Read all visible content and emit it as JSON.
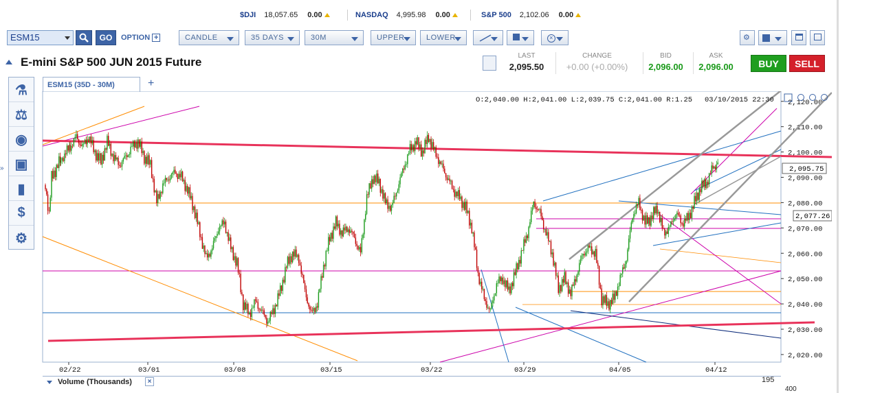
{
  "ticker": [
    {
      "name": "$DJI",
      "value": "18,057.65",
      "change": "0.00"
    },
    {
      "name": "NASDAQ",
      "value": "4,995.98",
      "change": "0.00"
    },
    {
      "name": "S&P 500",
      "value": "2,102.06",
      "change": "0.00"
    }
  ],
  "toolbar": {
    "symbol": "ESM15",
    "go": "GO",
    "option": "OPTION",
    "chart_type": "CANDLE",
    "range": "35 DAYS",
    "interval": "30M",
    "upper": "UPPER",
    "lower": "LOWER"
  },
  "title": "E-mini S&P 500 JUN 2015 Future",
  "quote": {
    "last_label": "LAST",
    "last": "2,095.50",
    "change_label": "CHANGE",
    "change": "+0.00 (+0.00%)",
    "bid_label": "BID",
    "bid": "2,096.00",
    "ask_label": "ASK",
    "ask": "2,096.00"
  },
  "buy_label": "BUY",
  "sell_label": "SELL",
  "tab_label": "ESM15 (35D - 30M)",
  "volume_panel": {
    "label": "Volume (Thousands)",
    "value": "195",
    "axis_top": "400"
  },
  "sidebar_icons": [
    "microscope-icon",
    "scale-icon",
    "eye-icon",
    "briefcase-icon",
    "bar-chart-icon",
    "dollar-icon",
    "gear-icon"
  ],
  "colors": {
    "up": "#1a9a1a",
    "down": "#c00000",
    "accent": "#3d64a6"
  },
  "chart_data": {
    "type": "candlestick",
    "ohlc_label": "O:2,040.00  H:2,041.00  L:2,039.75  C:2,041.00  R:1.25",
    "timestamp": "03/10/2015 22:30",
    "x_ticks": [
      "02/22",
      "03/01",
      "03/08",
      "03/15",
      "03/22",
      "03/29",
      "04/05",
      "04/12"
    ],
    "y_ticks": [
      "2,120.00",
      "2,110.00",
      "2,100.00",
      "2,090.00",
      "2,080.00",
      "2,070.00",
      "2,060.00",
      "2,050.00",
      "2,040.00",
      "2,030.00",
      "2,020.00"
    ],
    "ylim": [
      2017,
      2124
    ],
    "y_labels": [
      "2,095.75",
      "2,077.26"
    ],
    "price_path": [
      [
        0,
        2087
      ],
      [
        0.6,
        2075
      ],
      [
        1,
        2090
      ],
      [
        2.5,
        2097
      ],
      [
        4,
        2102
      ],
      [
        5,
        2106
      ],
      [
        6,
        2102
      ],
      [
        7,
        2106
      ],
      [
        8,
        2100
      ],
      [
        9,
        2096
      ],
      [
        10,
        2104
      ],
      [
        11,
        2098
      ],
      [
        12,
        2095
      ],
      [
        13,
        2098
      ],
      [
        14,
        2102
      ],
      [
        15,
        2104
      ],
      [
        16,
        2098
      ],
      [
        17,
        2095
      ],
      [
        18,
        2080
      ],
      [
        19,
        2087
      ],
      [
        20,
        2090
      ],
      [
        21,
        2092
      ],
      [
        22,
        2090
      ],
      [
        23,
        2085
      ],
      [
        24,
        2078
      ],
      [
        25,
        2068
      ],
      [
        26,
        2058
      ],
      [
        27,
        2062
      ],
      [
        28,
        2070
      ],
      [
        29,
        2072
      ],
      [
        30,
        2062
      ],
      [
        31,
        2056
      ],
      [
        32,
        2040
      ],
      [
        33,
        2036
      ],
      [
        34,
        2041
      ],
      [
        35,
        2037
      ],
      [
        36,
        2033
      ],
      [
        37,
        2038
      ],
      [
        38,
        2045
      ],
      [
        39,
        2055
      ],
      [
        40,
        2060
      ],
      [
        41,
        2058
      ],
      [
        42,
        2045
      ],
      [
        43,
        2036
      ],
      [
        44,
        2040
      ],
      [
        45,
        2055
      ],
      [
        46,
        2066
      ],
      [
        47,
        2072
      ],
      [
        48,
        2068
      ],
      [
        49,
        2070
      ],
      [
        50,
        2066
      ],
      [
        51,
        2060
      ],
      [
        52,
        2082
      ],
      [
        53,
        2090
      ],
      [
        54,
        2088
      ],
      [
        55,
        2080
      ],
      [
        56,
        2078
      ],
      [
        57,
        2086
      ],
      [
        58,
        2094
      ],
      [
        59,
        2101
      ],
      [
        60,
        2104
      ],
      [
        61,
        2100
      ],
      [
        62,
        2106
      ],
      [
        63,
        2100
      ],
      [
        64,
        2095
      ],
      [
        65,
        2090
      ],
      [
        66,
        2085
      ],
      [
        67,
        2082
      ],
      [
        68,
        2078
      ],
      [
        69,
        2070
      ],
      [
        70,
        2052
      ],
      [
        71,
        2042
      ],
      [
        72,
        2037
      ],
      [
        73,
        2048
      ],
      [
        74,
        2050
      ],
      [
        75,
        2045
      ],
      [
        76,
        2052
      ],
      [
        77,
        2060
      ],
      [
        78,
        2068
      ],
      [
        79,
        2080
      ],
      [
        80,
        2076
      ],
      [
        81,
        2068
      ],
      [
        82,
        2060
      ],
      [
        83,
        2046
      ],
      [
        84,
        2050
      ],
      [
        85,
        2044
      ],
      [
        86,
        2052
      ],
      [
        87,
        2060
      ],
      [
        88,
        2062
      ],
      [
        89,
        2060
      ],
      [
        90,
        2042
      ],
      [
        91,
        2040
      ],
      [
        92,
        2042
      ],
      [
        93,
        2050
      ],
      [
        94,
        2058
      ],
      [
        95,
        2075
      ],
      [
        96,
        2080
      ],
      [
        97,
        2072
      ],
      [
        98,
        2074
      ],
      [
        99,
        2078
      ],
      [
        100,
        2068
      ],
      [
        101,
        2070
      ],
      [
        102,
        2076
      ],
      [
        103,
        2072
      ],
      [
        104,
        2074
      ],
      [
        105,
        2080
      ],
      [
        106,
        2086
      ],
      [
        107,
        2088
      ],
      [
        108,
        2094
      ],
      [
        109,
        2096
      ]
    ]
  }
}
